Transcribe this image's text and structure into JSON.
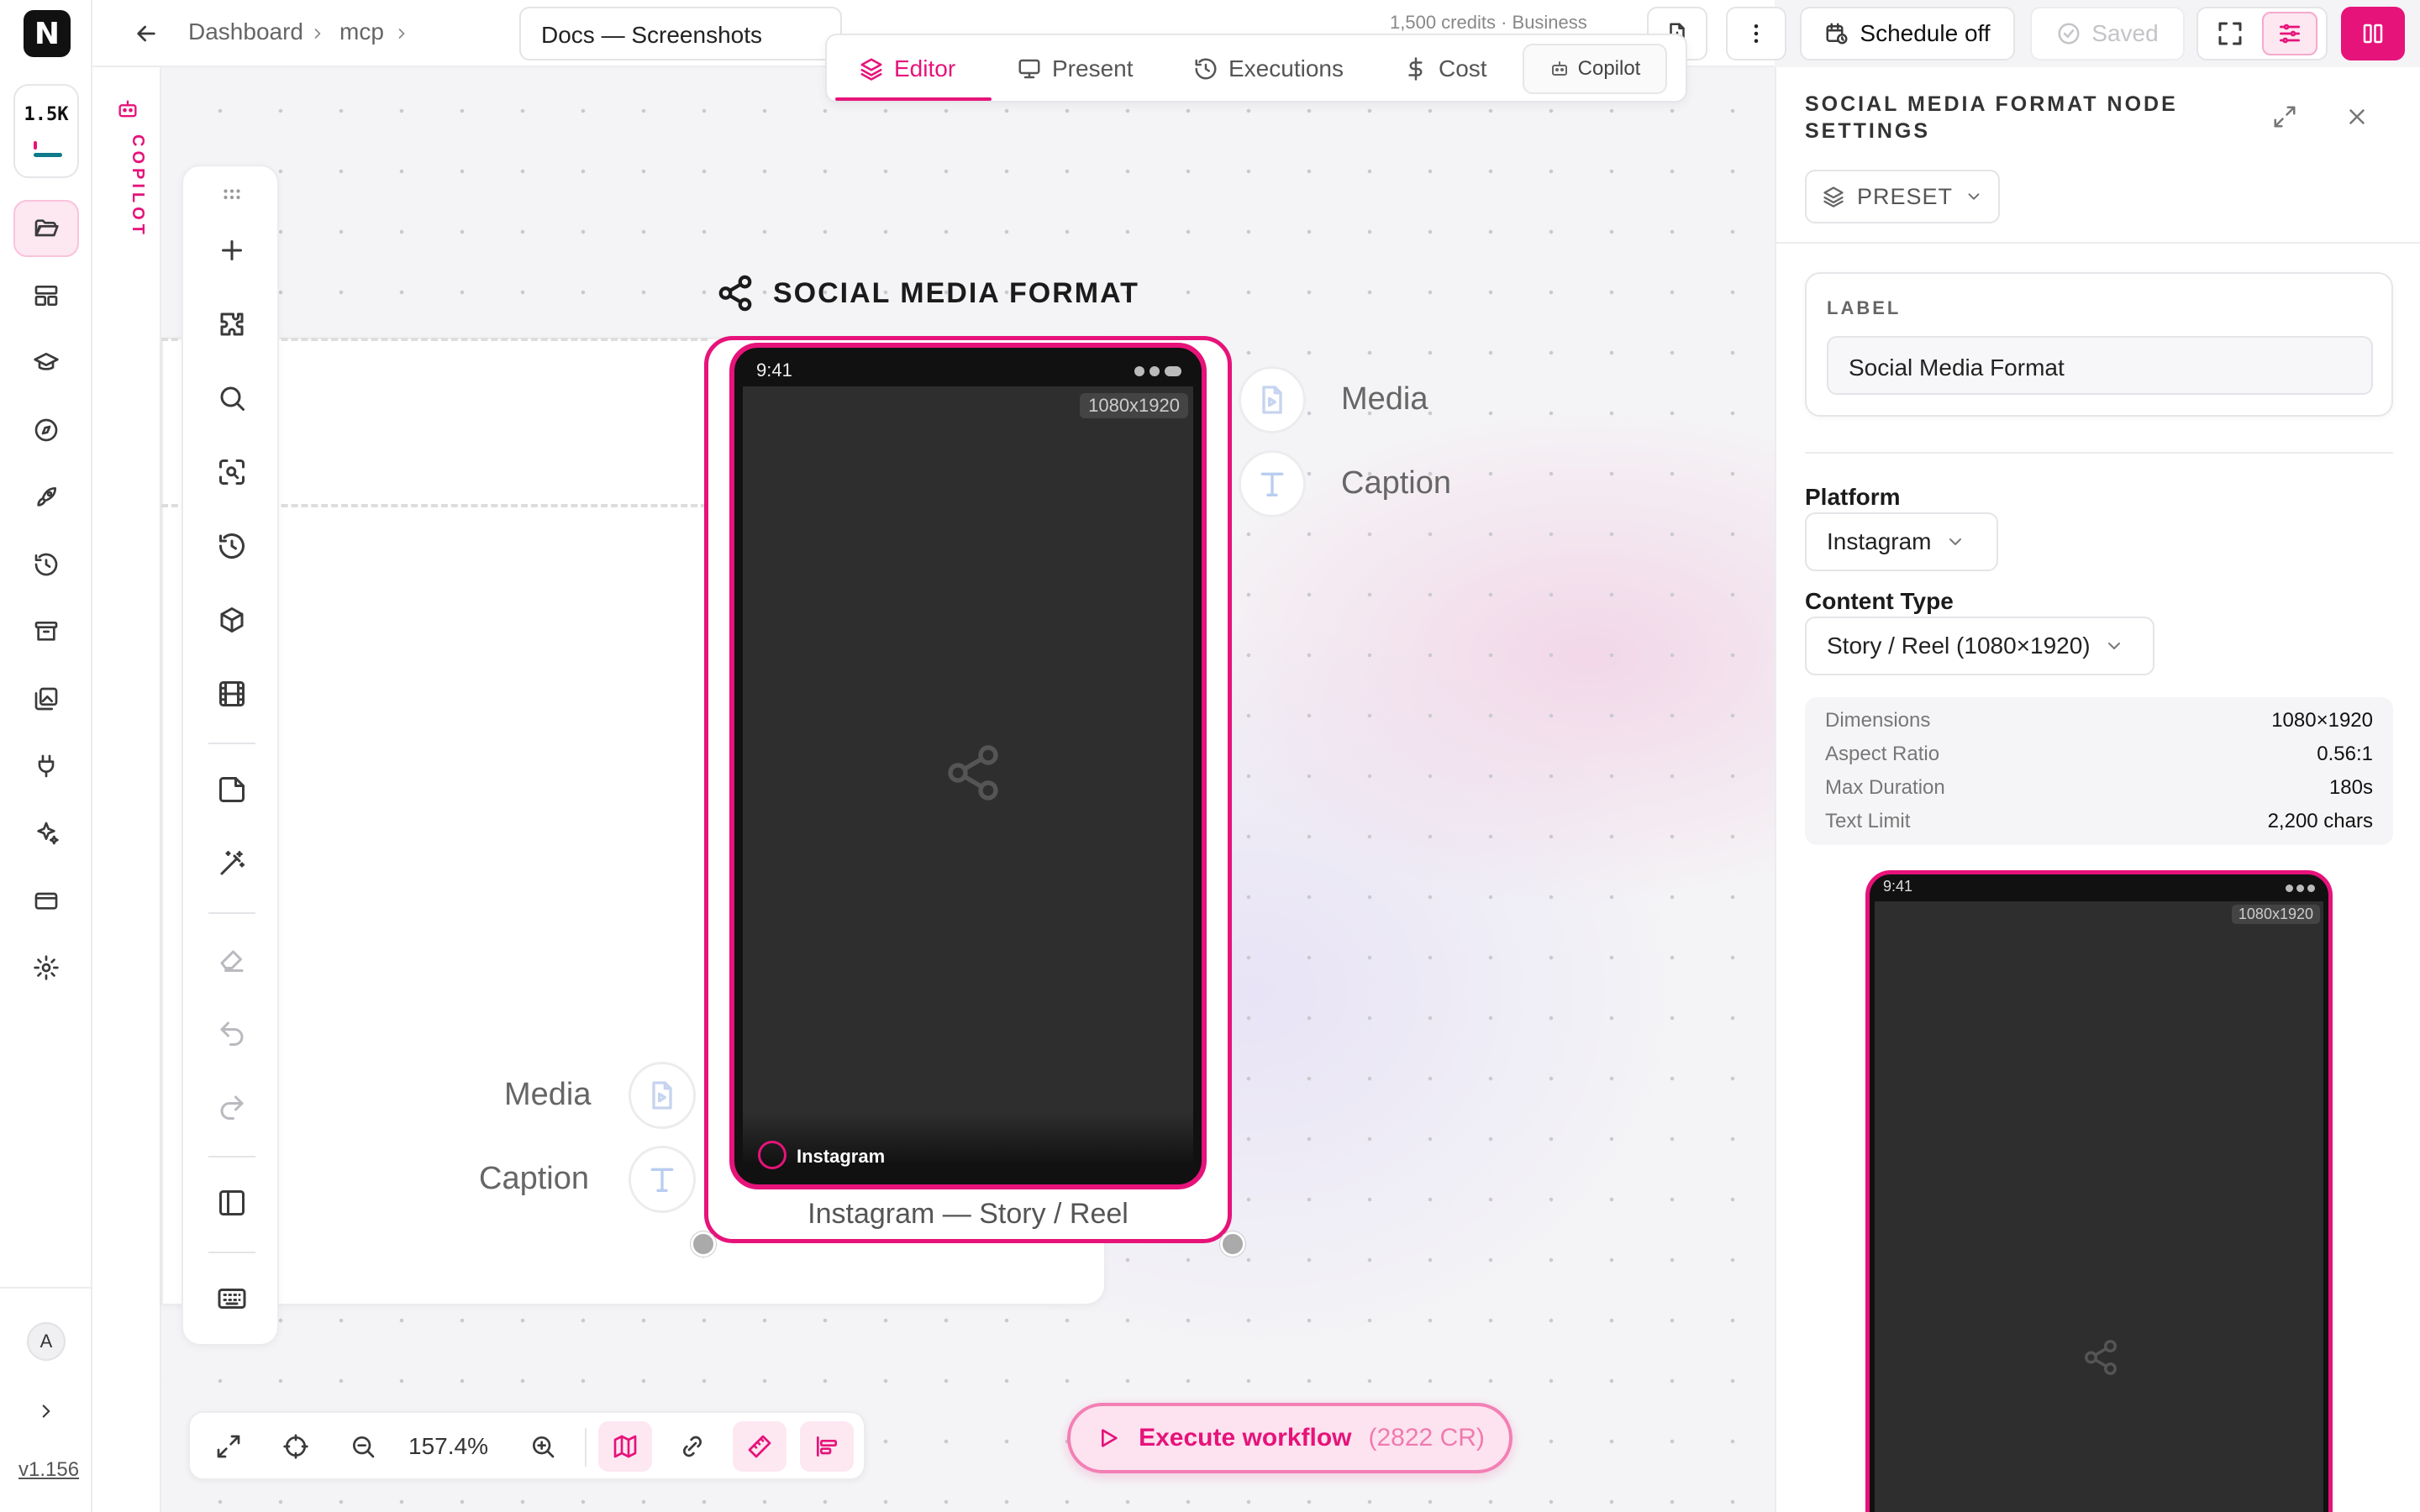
{
  "app": {
    "logo": "N",
    "credits_badge": "1.5K",
    "version": "v1.156",
    "avatar_initial": "A",
    "accent": "#e6137a",
    "copilot_vertical": "COPILOT"
  },
  "breadcrumb": {
    "items": [
      "Dashboard",
      "mcp"
    ],
    "doc_title": "Docs — Screenshots"
  },
  "topbar": {
    "credits_text": "1,500 credits · Business",
    "schedule_label": "Schedule off",
    "saved_label": "Saved"
  },
  "mode_tabs": [
    {
      "label": "Editor",
      "icon": "layers-icon",
      "active": true
    },
    {
      "label": "Present",
      "icon": "monitor-icon",
      "active": false
    },
    {
      "label": "Executions",
      "icon": "history-icon",
      "active": false
    },
    {
      "label": "Cost",
      "icon": "dollar-icon",
      "active": false
    }
  ],
  "copilot_button": "Copilot",
  "node": {
    "title": "SOCIAL MEDIA FORMAT",
    "phone_time": "9:41",
    "dimensions_badge": "1080x1920",
    "platform_label": "Instagram",
    "caption": "Instagram — Story / Reel",
    "inputs": [
      "Media",
      "Caption"
    ],
    "outputs": [
      "Media",
      "Caption"
    ]
  },
  "zoom": {
    "value": "157.4%"
  },
  "execute": {
    "label": "Execute workflow",
    "cost": "(2822 CR)"
  },
  "panel": {
    "title": "SOCIAL MEDIA FORMAT NODE SETTINGS",
    "preset_label": "PRESET",
    "label_heading": "LABEL",
    "label_value": "Social Media Format",
    "platform_heading": "Platform",
    "platform_value": "Instagram",
    "content_type_heading": "Content Type",
    "content_type_value": "Story / Reel (1080×1920)",
    "stats": [
      {
        "key": "Dimensions",
        "value": "1080×1920"
      },
      {
        "key": "Aspect Ratio",
        "value": "0.56:1"
      },
      {
        "key": "Max Duration",
        "value": "180s"
      },
      {
        "key": "Text Limit",
        "value": "2,200 chars"
      }
    ],
    "preview_time": "9:41",
    "preview_badge": "1080x1920"
  }
}
